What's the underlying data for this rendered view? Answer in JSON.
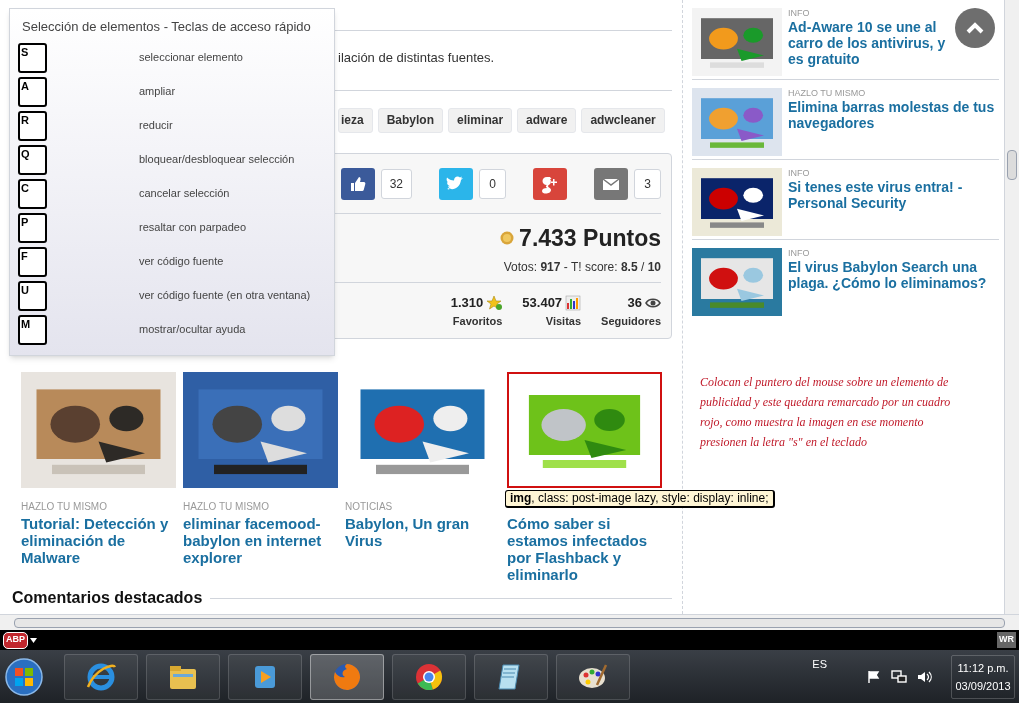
{
  "help_panel": {
    "title": "Selección de elementos - Teclas de acceso rápido",
    "shortcuts": [
      {
        "key": "S",
        "action": "seleccionar elemento"
      },
      {
        "key": "A",
        "action": "ampliar"
      },
      {
        "key": "R",
        "action": "reducir"
      },
      {
        "key": "Q",
        "action": "bloquear/desbloquear selección"
      },
      {
        "key": "C",
        "action": "cancelar selección"
      },
      {
        "key": "P",
        "action": "resaltar con parpadeo"
      },
      {
        "key": "F",
        "action": "ver código fuente"
      },
      {
        "key": "U",
        "action": "ver código fuente (en otra ventana)"
      },
      {
        "key": "M",
        "action": "mostrar/ocultar ayuda"
      }
    ]
  },
  "article": {
    "intro_text": "ilación de distintas fuentes.",
    "tags": [
      "ieza",
      "Babylon",
      "eliminar",
      "adware",
      "adwcleaner"
    ],
    "share": [
      {
        "kind": "facebook",
        "count": "32"
      },
      {
        "kind": "twitter",
        "count": "0"
      },
      {
        "kind": "googleplus"
      },
      {
        "kind": "email",
        "count": "3"
      }
    ],
    "points": "7.433 Puntos",
    "votes": "Votos: **917** - T! score: **8.5** / **10**",
    "stats": [
      {
        "kind": "favorites",
        "value": "1.310",
        "label": "Favoritos"
      },
      {
        "kind": "visits",
        "value": "53.407",
        "label": "Visitas"
      },
      {
        "kind": "followers",
        "value": "36",
        "label": "Seguidores"
      }
    ]
  },
  "related_posts": [
    {
      "category": "HAZLO TU MISMO",
      "title": "Tutorial: Detección y eliminación de Malware",
      "selected": false
    },
    {
      "category": "HAZLO TU MISMO",
      "title": "eliminar facemood-babylon en internet explorer",
      "selected": false
    },
    {
      "category": "NOTICIAS",
      "title": "Babylon, Un gran Virus",
      "selected": false
    },
    {
      "title": "Cómo saber si estamos infectados por Flashback y eliminarlo",
      "selected": true,
      "tooltip": "**img**, class: post-image lazy, style: display: inline;"
    }
  ],
  "annotation": "Colocan el puntero del mouse sobre un elemento de publicidad y este quedara remarcado por un cuadro rojo, como muestra la imagen en ese momento presionen la letra \"s\" en el teclado",
  "comments_heading": "Comentarios destacados",
  "sidebar_posts": [
    {
      "category": "INFO",
      "title": "Ad-Aware 10 se une al carro de los antivirus, y es gratuito"
    },
    {
      "category": "HAZLO TU MISMO",
      "title": "Elimina barras molestas de tus navegadores"
    },
    {
      "category": "INFO",
      "title": "Si tenes este virus entra! - Personal Security"
    },
    {
      "category": "INFO",
      "title": "El virus Babylon Search una plaga. ¿Cómo lo eliminamos?"
    }
  ],
  "addon_bar": {
    "adblock_label": "ABP",
    "badge": "WR"
  },
  "taskbar": {
    "apps": [
      {
        "kind": "ie",
        "active": false
      },
      {
        "kind": "explorer",
        "active": false
      },
      {
        "kind": "media",
        "active": false
      },
      {
        "kind": "firefox",
        "active": true
      },
      {
        "kind": "chrome",
        "active": false
      },
      {
        "kind": "notepad",
        "active": false
      },
      {
        "kind": "paint",
        "active": false
      }
    ],
    "language": "ES",
    "time": "11:12 p.m.",
    "date": "03/09/2013"
  }
}
